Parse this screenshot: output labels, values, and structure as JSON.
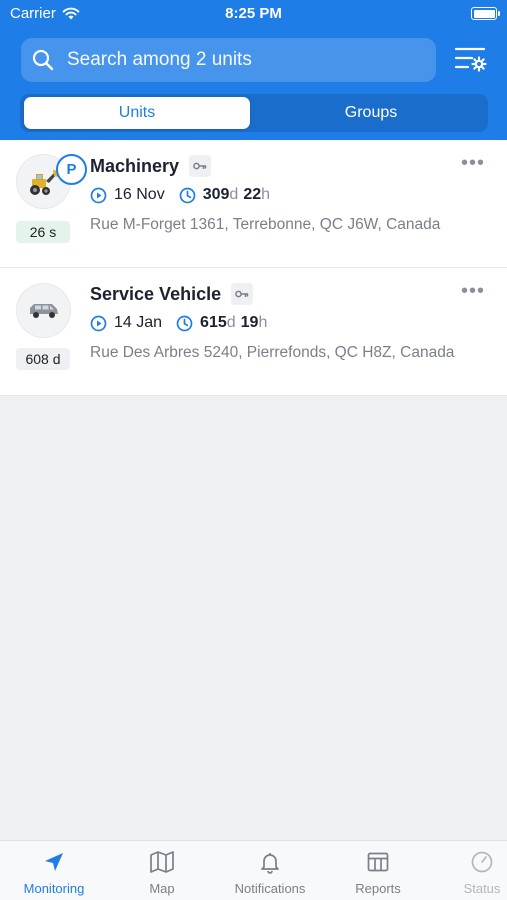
{
  "status_bar": {
    "carrier": "Carrier",
    "time": "8:25 PM"
  },
  "search": {
    "placeholder": "Search among 2 units"
  },
  "segments": {
    "units": "Units",
    "groups": "Groups",
    "selected": "Units"
  },
  "units": [
    {
      "name": "Machinery",
      "parking_badge": "P",
      "age": "26 s",
      "date": "16 Nov",
      "duration_value_1": "309",
      "duration_unit_1": "d",
      "duration_value_2": "22",
      "duration_unit_2": "h",
      "address": "Rue M-Forget 1361, Terrebonne, QC J6W, Canada",
      "icon": "loader-tractor-icon"
    },
    {
      "name": "Service Vehicle",
      "age": "608 d",
      "date": "14 Jan",
      "duration_value_1": "615",
      "duration_unit_1": "d",
      "duration_value_2": "19",
      "duration_unit_2": "h",
      "address": "Rue Des Arbres 5240, Pierrefonds, QC H8Z, Canada",
      "icon": "van-icon"
    }
  ],
  "tabbar": {
    "monitoring": "Monitoring",
    "map": "Map",
    "notifications": "Notifications",
    "reports": "Reports",
    "status": "Status",
    "active": "Monitoring"
  },
  "colors": {
    "accent": "#1f7de8",
    "text": "#1c2230",
    "muted": "#7a808a"
  }
}
